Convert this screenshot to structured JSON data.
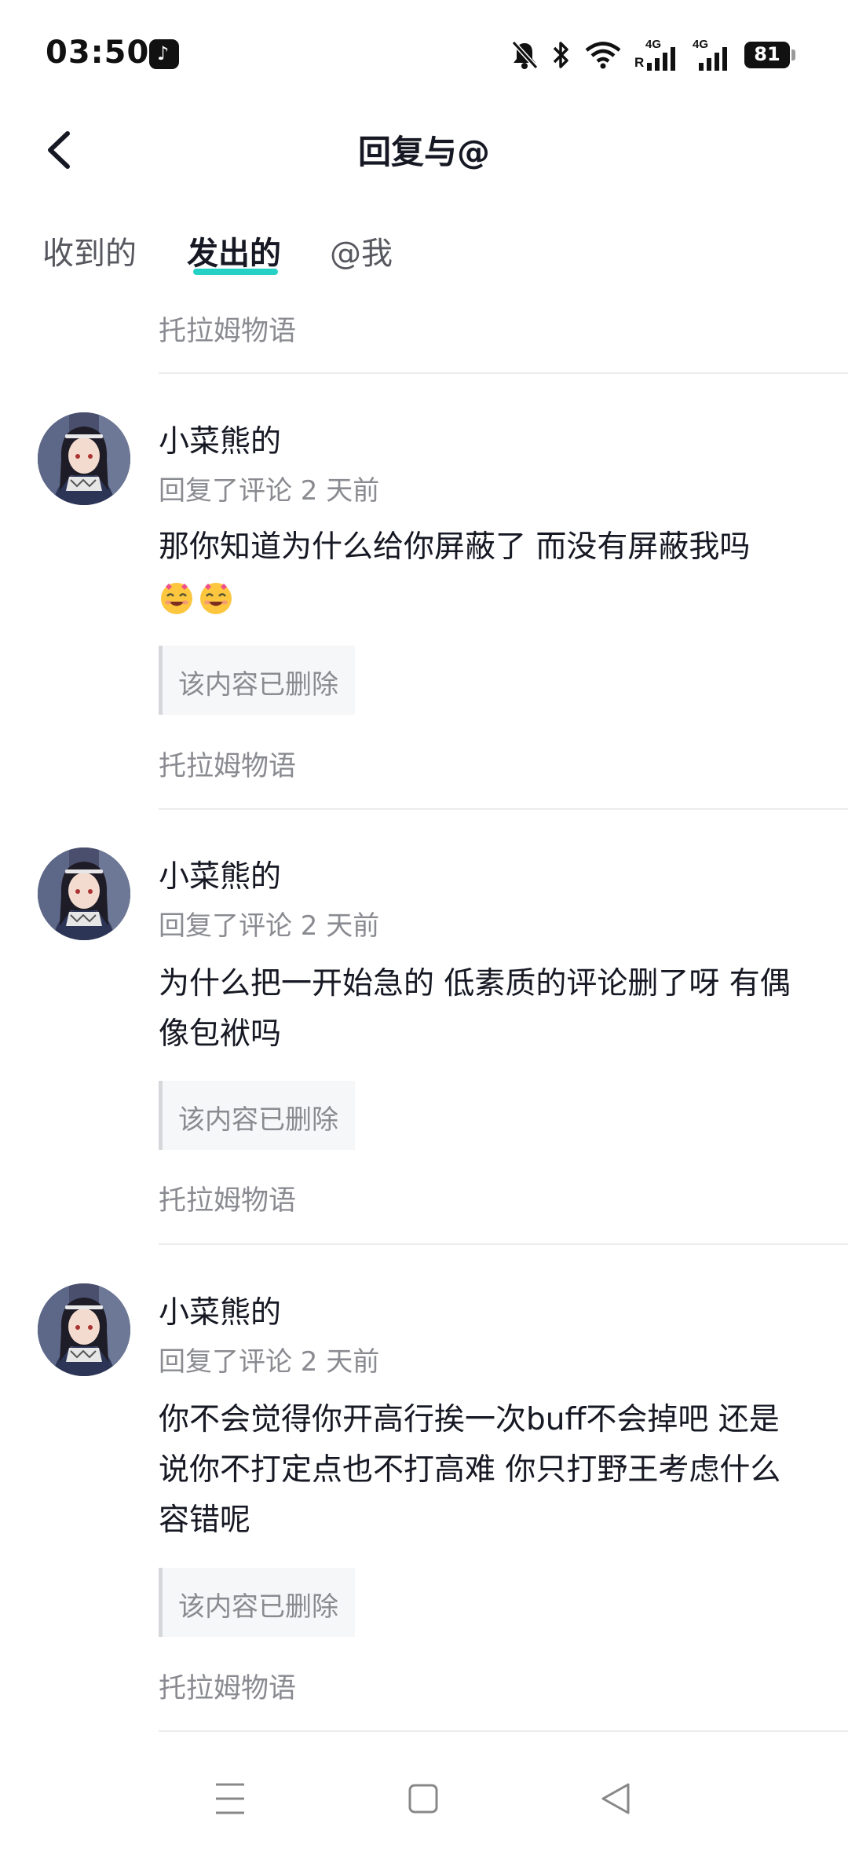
{
  "status_bar": {
    "time": "03:50",
    "net_1": "4G",
    "net_1_roaming": "R",
    "net_2": "4G",
    "battery": "81",
    "icons": [
      "tiktok-icon",
      "bell-muted-icon",
      "bluetooth-icon",
      "wifi-icon",
      "signal-icon",
      "signal-icon",
      "battery-icon"
    ]
  },
  "header": {
    "title": "回复与@"
  },
  "tabs": [
    {
      "label": "收到的",
      "active": false
    },
    {
      "label": "发出的",
      "active": true
    },
    {
      "label": "@我",
      "active": false
    }
  ],
  "accent_color": "#25d0c4",
  "top_item_source": "托拉姆物语",
  "items": [
    {
      "author": "小菜熊的",
      "meta": "回复了评论 2 天前",
      "text": "那你知道为什么给你屏蔽了 而没有屏蔽我吗",
      "emojis": [
        "heart-eyes-emoji",
        "heart-eyes-emoji"
      ],
      "quote": "该内容已删除",
      "source": "托拉姆物语"
    },
    {
      "author": "小菜熊的",
      "meta": "回复了评论 2 天前",
      "text": "为什么把一开始急的 低素质的评论删了呀 有偶像包袱吗",
      "quote": "该内容已删除",
      "source": "托拉姆物语"
    },
    {
      "author": "小菜熊的",
      "meta": "回复了评论 2 天前",
      "text": "你不会觉得你开高行挨一次buff不会掉吧 还是说你不打定点也不打高难 你只打野王考虑什么容错呢",
      "quote": "该内容已删除",
      "source": "托拉姆物语"
    }
  ],
  "nav": [
    "menu-icon",
    "home-icon",
    "back-icon"
  ]
}
